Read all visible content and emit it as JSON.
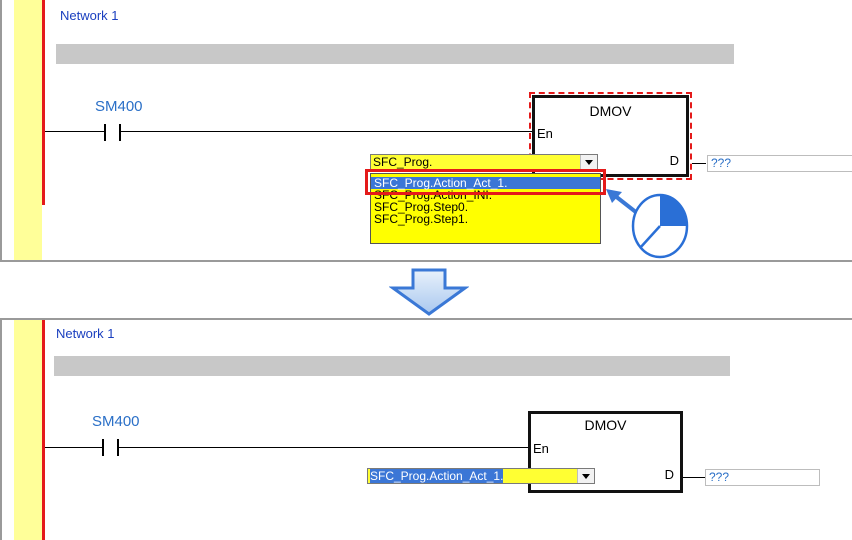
{
  "top_panel": {
    "network_title": "Network 1",
    "contact_label": "SM400",
    "instruction": "DMOV",
    "pin_en": "En",
    "pin_d": "D",
    "combo_value": "SFC_Prog.",
    "dropdown_items": [
      "SFC_Prog.Action_Act_1.",
      "SFC_Prog.Action_INI.",
      "SFC_Prog.Step0.",
      "SFC_Prog.Step1."
    ],
    "selected_index": 0,
    "output_value": "???"
  },
  "bottom_panel": {
    "network_title": "Network 1",
    "contact_label": "SM400",
    "instruction": "DMOV",
    "pin_en": "En",
    "pin_d": "D",
    "combo_value": "SFC_Prog.Action_Act_1.",
    "output_value": "???"
  },
  "colors": {
    "power_rail": "#e41a1a",
    "left_margin": "#ffff99",
    "highlight_box": "#e41a1a",
    "combo_background": "#ffff33",
    "selection": "#3b76d6",
    "transition_arrow": "#3a78d6"
  },
  "icons": {
    "transition": "down-arrow-icon",
    "pointer": "pointer-arrow-icon",
    "click": "mouse-click-icon"
  }
}
